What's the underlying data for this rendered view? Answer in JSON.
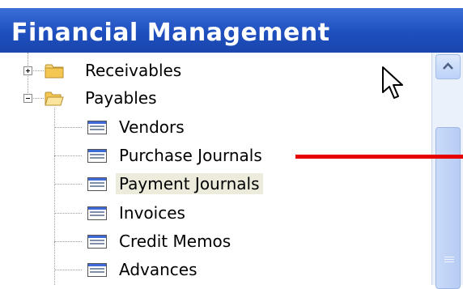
{
  "window": {
    "title": "Financial Management"
  },
  "tree": {
    "groups": [
      {
        "label": "Receivables",
        "expanded": false
      },
      {
        "label": "Payables",
        "expanded": true
      }
    ],
    "payables_items": [
      {
        "label": "Vendors"
      },
      {
        "label": "Purchase Journals"
      },
      {
        "label": "Payment Journals",
        "selected": true
      },
      {
        "label": "Invoices"
      },
      {
        "label": "Credit Memos"
      },
      {
        "label": "Advances"
      }
    ]
  },
  "icons": {
    "expander_collapsed": "plus-box-icon",
    "expander_expanded": "minus-box-icon",
    "folder_closed": "folder-closed-icon",
    "folder_open": "folder-open-icon",
    "form": "form-window-icon",
    "cursor": "mouse-pointer-icon",
    "scroll_up": "chevron-up-icon"
  },
  "colors": {
    "title_bar": "#1e4fbf",
    "selection": "#ecebdc",
    "annotation": "#e60000"
  }
}
